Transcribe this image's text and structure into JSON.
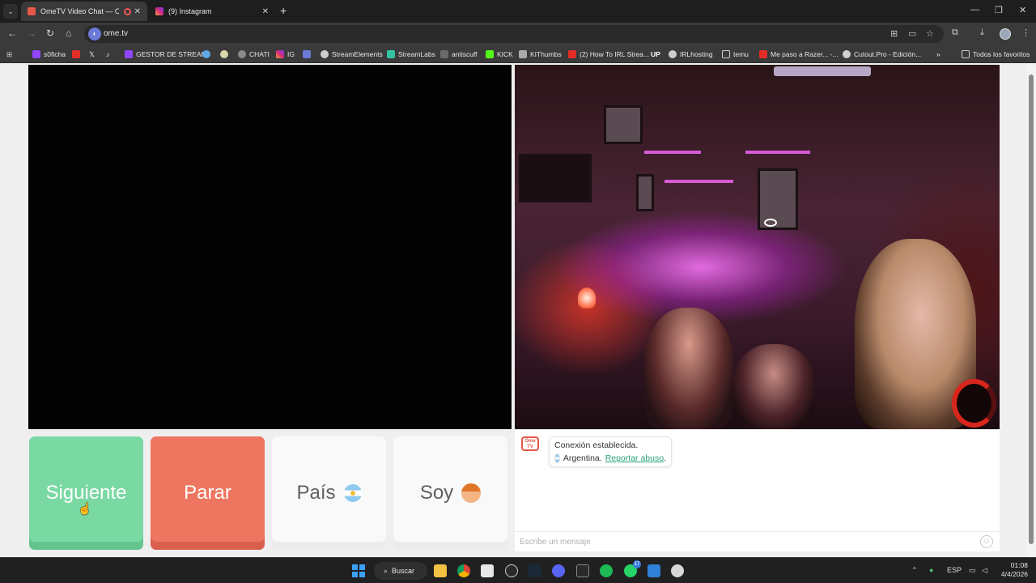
{
  "browser": {
    "tabs": [
      {
        "label": "OmeTV Video Chat — Ome",
        "active": true
      },
      {
        "label": "(9) Instagram",
        "active": false
      }
    ],
    "url": "ome.tv",
    "bookmarks": [
      "s0ficha",
      "GESTOR DE STREAM",
      "CHATI",
      "IG",
      "StreamElements",
      "StreamLabs",
      "antiscuff",
      "KICK",
      "KIThumbs",
      "(2) How To IRL Strea...",
      "IRLhosting",
      "temu",
      "Me paso a Razer... -...",
      "Cutout.Pro - Edición..."
    ],
    "bookmarks_more": "»",
    "all_bookmarks": "Todos los favoritos"
  },
  "controls": {
    "next_label": "Siguiente",
    "stop_label": "Parar",
    "country_label": "País",
    "gender_label": "Soy"
  },
  "chat": {
    "logo_text": "Ome TV",
    "connection_text": "Conexión establecida.",
    "country_text": "Argentina.",
    "report_link": "Reportar abuso",
    "report_suffix": ".",
    "input_placeholder": "Escribe un mensaje"
  },
  "taskbar": {
    "search_label": "Buscar",
    "whatsapp_badge": "17",
    "language": "ESP",
    "time": "01:08",
    "date": "4/4/2026"
  },
  "colors": {
    "next_button": "#7ad8a3",
    "stop_button": "#ee7660",
    "report_link": "#2aa37a",
    "accent_logo": "#e5584a"
  },
  "icons": {
    "browser": [
      "back-icon",
      "forward-icon",
      "reload-icon",
      "home-icon",
      "translate-icon",
      "cast-icon",
      "star-icon",
      "extensions-icon",
      "download-icon",
      "menu-icon"
    ],
    "chat": [
      "emoji-icon"
    ]
  }
}
